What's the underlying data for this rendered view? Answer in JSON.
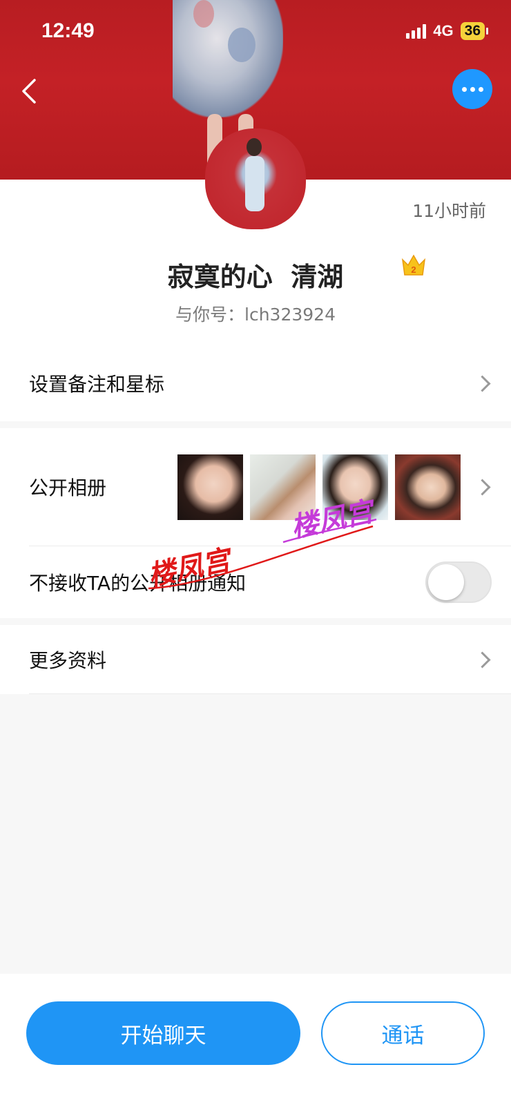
{
  "status_bar": {
    "time": "12:49",
    "network": "4G",
    "battery": "36"
  },
  "header": {
    "back_icon": "chevron-left-icon",
    "more_icon": "more-dots-icon",
    "accent_color": "#1f98ff"
  },
  "profile": {
    "time_ago": "11小时前",
    "nickname": "寂寞的心  清湖",
    "crown_level": "2",
    "uid": "与你号：lch323924"
  },
  "menu": {
    "remark_label": "设置备注和星标",
    "album_label": "公开相册",
    "album_photo_count": 4,
    "mute_label": "不接收TA的公开相册通知",
    "mute_enabled": false,
    "more_info_label": "更多资料"
  },
  "watermark": {
    "text_1": "楼凤宫",
    "text_2": "楼凤宫"
  },
  "actions": {
    "chat_label": "开始聊天",
    "call_label": "通话"
  }
}
